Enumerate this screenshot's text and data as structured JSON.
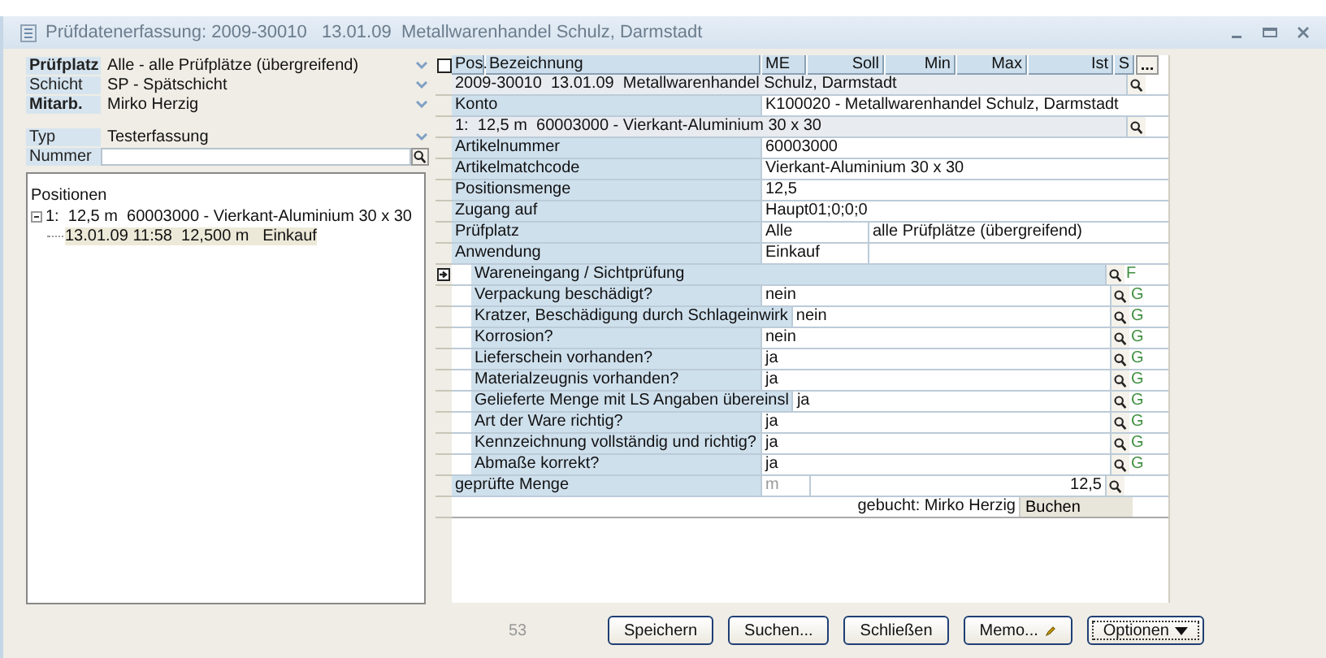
{
  "window": {
    "title": "Prüfdatenerfassung: 2009-30010   13.01.09  Metallwarenhandel Schulz, Darmstadt"
  },
  "filters": [
    {
      "label": "Prüfplatz",
      "value": "Alle - alle Prüfplätze (übergreifend)",
      "kind": "dropdown",
      "bold": true
    },
    {
      "label": "Schicht",
      "value": "SP - Spätschicht",
      "kind": "dropdown",
      "bold": false
    },
    {
      "label": "Mitarb.",
      "value": "Mirko Herzig",
      "kind": "dropdown",
      "bold": true
    },
    {
      "label": "Typ",
      "value": "Testerfassung",
      "kind": "dropdown",
      "bold": false
    },
    {
      "label": "Nummer",
      "kind": "search",
      "bold": false
    }
  ],
  "tree": {
    "title": "Positionen",
    "items": [
      {
        "label": "1:  12,5 m  60003000 - Vierkant-Aluminium 30 x 30",
        "expanded": true,
        "selected": false,
        "children": [
          {
            "label": "13.01.09 11:58  12,500 m   Einkauf",
            "selected": true
          }
        ]
      }
    ]
  },
  "grid": {
    "select_all": {
      "checked": false
    },
    "columns": [
      "Pos.",
      "Bezeichnung",
      "ME",
      "Soll",
      "Min",
      "Max",
      "Ist",
      "S",
      "..."
    ],
    "rows": [
      {
        "kind": "header",
        "label": "2009-30010  13.01.09  Metallwarenhandel Schulz, Darmstadt",
        "current": false
      },
      {
        "kind": "field",
        "label": "Konto",
        "value": "K100020 - Metallwarenhandel Schulz, Darmstadt",
        "current": false
      },
      {
        "kind": "header",
        "label": "1:  12,5 m  60003000 - Vierkant-Aluminium 30 x 30",
        "current": false
      },
      {
        "kind": "field",
        "label": "Artikelnummer",
        "value": "60003000",
        "current": false
      },
      {
        "kind": "field",
        "label": "Artikelmatchcode",
        "value": "Vierkant-Aluminium 30 x 30",
        "current": false
      },
      {
        "kind": "field",
        "label": "Positionsmenge",
        "value": "12,5",
        "current": false
      },
      {
        "kind": "field",
        "label": "Zugang auf",
        "value": "Haupt01;0;0;0",
        "current": false
      },
      {
        "kind": "split",
        "label": "Prüfplatz",
        "value": "Alle",
        "extra": "alle Prüfplätze (übergreifend)",
        "current": false
      },
      {
        "kind": "split",
        "label": "Anwendung",
        "value": "Einkauf",
        "current": false
      },
      {
        "kind": "group",
        "label": "Wareneingang / Sichtprüfung",
        "flag": "F",
        "current": true
      },
      {
        "kind": "check",
        "label": "Verpackung beschädigt?",
        "value": "nein",
        "flag": "G",
        "current": false
      },
      {
        "kind": "check",
        "label": "Kratzer, Beschädigung durch Schlageinwirk",
        "value": "nein",
        "flag": "G",
        "current": false
      },
      {
        "kind": "check",
        "label": "Korrosion?",
        "value": "nein",
        "flag": "G",
        "current": false
      },
      {
        "kind": "check",
        "label": "Lieferschein vorhanden?",
        "value": "ja",
        "flag": "G",
        "current": false
      },
      {
        "kind": "check",
        "label": "Materialzeugnis vorhanden?",
        "value": "ja",
        "flag": "G",
        "current": false
      },
      {
        "kind": "check",
        "label": "Gelieferte Menge mit LS Angaben übereinsl",
        "value": "ja",
        "flag": "G",
        "current": false
      },
      {
        "kind": "check",
        "label": "Art der Ware richtig?",
        "value": "ja",
        "flag": "G",
        "current": false
      },
      {
        "kind": "check",
        "label": "Kennzeichnung vollständig und richtig?",
        "value": "ja",
        "flag": "G",
        "current": false
      },
      {
        "kind": "check",
        "label": "Abmaße korrekt?",
        "value": "ja",
        "flag": "G",
        "current": false
      },
      {
        "kind": "quantity",
        "label": "geprüfte Menge",
        "unit": "m",
        "value": "12,5",
        "current": false
      },
      {
        "kind": "booking",
        "label": "gebucht: Mirko Herzig",
        "button": "Buchen",
        "current": false
      }
    ]
  },
  "footer": {
    "count": "53",
    "buttons": [
      {
        "label": "Speichern",
        "kind": "plain",
        "focused": false
      },
      {
        "label": "Suchen...",
        "kind": "plain",
        "focused": false
      },
      {
        "label": "Schließen",
        "kind": "plain",
        "focused": false
      },
      {
        "label": "Memo...",
        "kind": "memo",
        "focused": false
      },
      {
        "label": "Optionen",
        "kind": "menu",
        "focused": true
      }
    ]
  }
}
